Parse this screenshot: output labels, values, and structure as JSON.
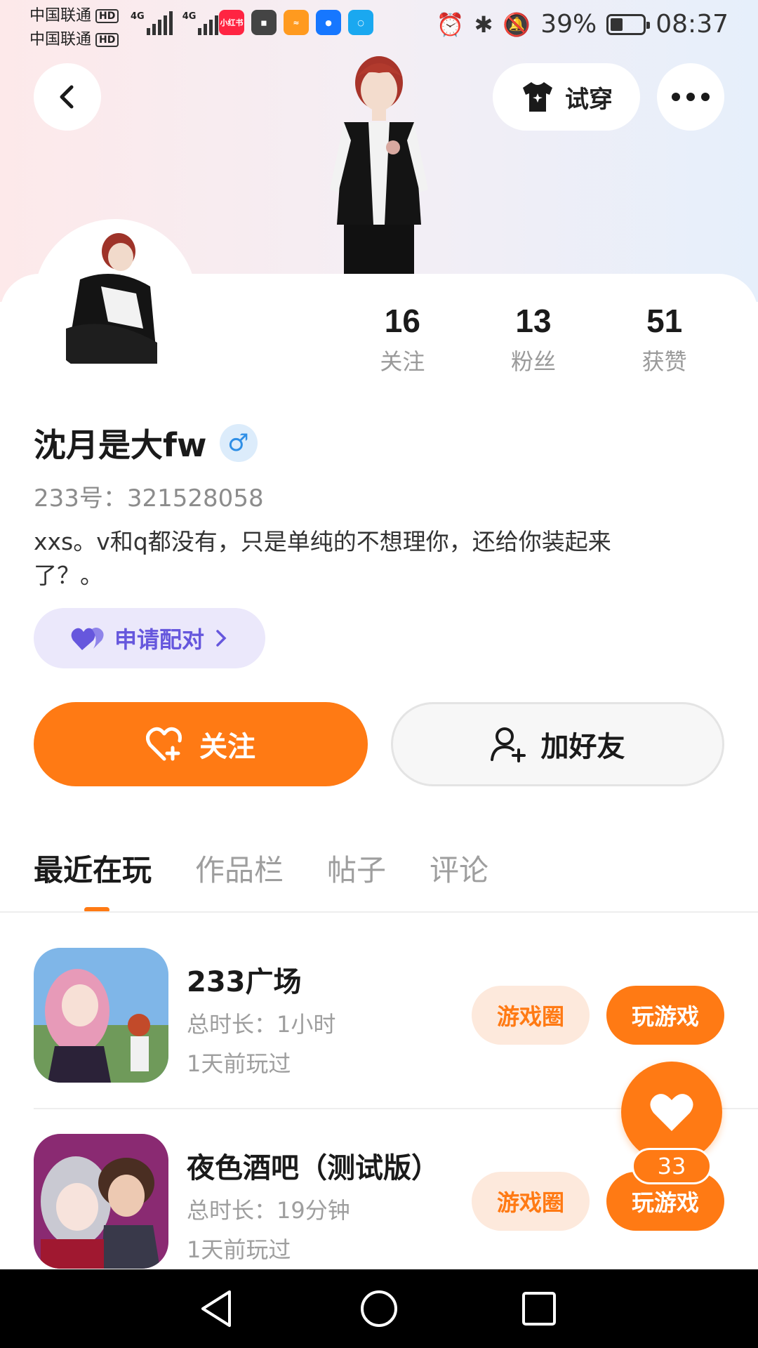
{
  "status_bar": {
    "carrier_1": "中国联通",
    "carrier_2": "中国联通",
    "hd_badge": "HD",
    "network_1": "4G",
    "network_2": "4G",
    "battery_percent": "39%",
    "battery_level": 0.39,
    "time": "08:37",
    "app_icons": [
      "xiaohongshu-icon",
      "huawei-appgallery-icon",
      "orange-app-icon",
      "bulb-icon",
      "search-app-icon"
    ]
  },
  "header": {
    "back_icon": "chevron-left-icon",
    "tryon_label": "试穿",
    "more_icon": "more-horizontal-icon"
  },
  "profile": {
    "stats": [
      {
        "value": "16",
        "label": "关注"
      },
      {
        "value": "13",
        "label": "粉丝"
      },
      {
        "value": "51",
        "label": "获赞"
      }
    ],
    "username": "沈月是大fw",
    "gender_symbol": "♂",
    "uid": "233号：321528058",
    "bio": "xxs。v和q都没有，只是单纯的不想理你，还给你装起来了？。",
    "pair_label": "申请配对",
    "follow_label": "关注",
    "add_friend_label": "加好友"
  },
  "tabs": [
    {
      "label": "最近在玩",
      "active": true
    },
    {
      "label": "作品栏",
      "active": false
    },
    {
      "label": "帖子",
      "active": false
    },
    {
      "label": "评论",
      "active": false
    }
  ],
  "games": [
    {
      "name": "233广场",
      "duration": "总时长：1小时",
      "last_played": "1天前玩过",
      "circle_label": "游戏圈",
      "play_label": "玩游戏"
    },
    {
      "name": "夜色酒吧（测试版）",
      "duration": "总时长：19分钟",
      "last_played": "1天前玩过",
      "circle_label": "游戏圈",
      "play_label": "玩游戏"
    }
  ],
  "like_fab": {
    "count": "33"
  },
  "colors": {
    "accent": "#ff7a14",
    "pair_purple": "#6657dd",
    "gender_blue": "#2f8fe6"
  }
}
